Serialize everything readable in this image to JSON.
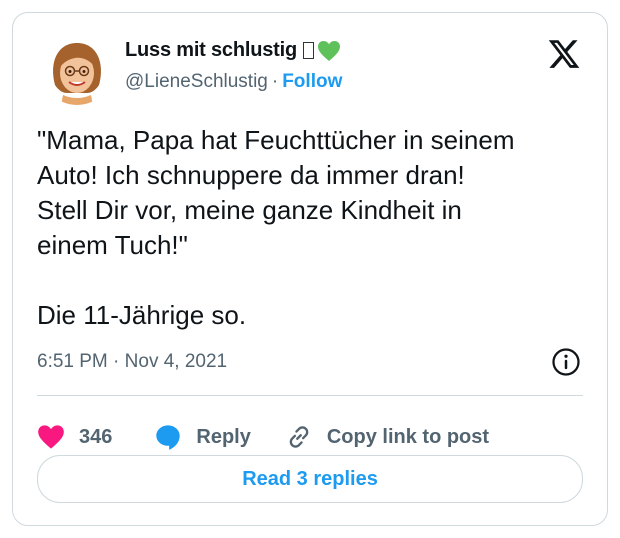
{
  "tweet": {
    "author": {
      "display_name": "Luss mit schlustig",
      "handle": "@LieneSchlustig",
      "follow_label": "Follow"
    },
    "text": "\"Mama, Papa hat Feuchttücher in seinem\nAuto! Ich schnuppere da immer dran!\nStell Dir vor, meine ganze Kindheit in\neinem Tuch!\"\n\nDie 11-Jährige so.",
    "time": "6:51 PM",
    "date": "Nov 4, 2021",
    "meta_separator": "·",
    "handle_separator": "·",
    "likes": "346",
    "reply_label": "Reply",
    "copy_link_label": "Copy link to post",
    "read_replies_label": "Read 3 replies"
  },
  "icons": {
    "logo": "x-logo-icon",
    "info": "info-icon",
    "like": "heart-icon",
    "reply": "speech-bubble-icon",
    "copy": "link-icon"
  },
  "colors": {
    "accent": "#1d9bf0",
    "heart": "#f91880",
    "secondary_text": "#536471",
    "border": "#cfd9de",
    "badge_heart": "#5fc15a"
  }
}
